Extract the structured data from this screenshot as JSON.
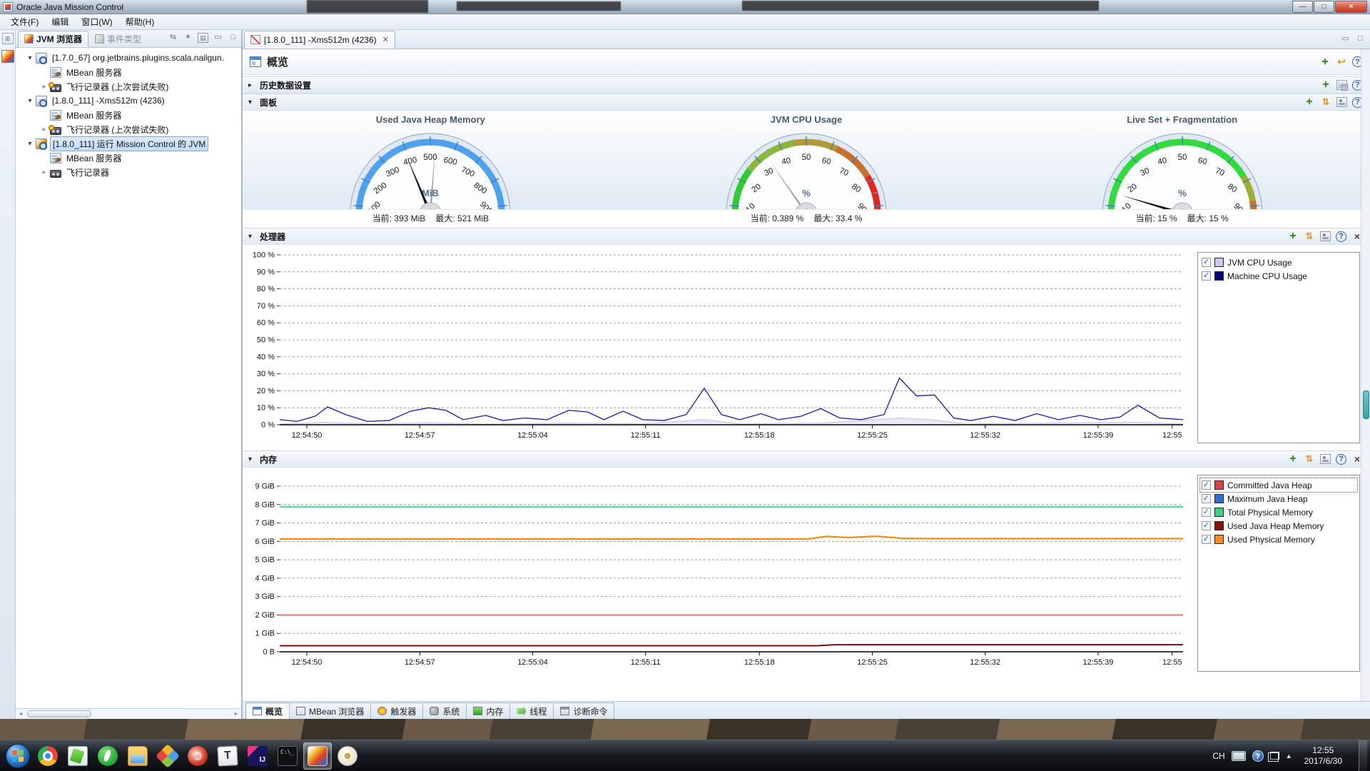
{
  "window": {
    "title": "Oracle Java Mission Control"
  },
  "menu": {
    "items": [
      "文件(F)",
      "编辑",
      "窗口(W)",
      "帮助(H)"
    ]
  },
  "sidebar": {
    "tabs": [
      {
        "label": "JVM 浏览器",
        "active": true
      },
      {
        "label": "事件类型",
        "active": false
      }
    ],
    "tree": [
      {
        "label": "[1.7.0_67] org.jetbrains.plugins.scala.nailgun.",
        "level": 0,
        "expander": "expanded",
        "icon": "jvm-connection-icon",
        "selected": false
      },
      {
        "label": "MBean 服务器",
        "level": 1,
        "expander": "none",
        "icon": "mbean-server-icon",
        "selected": false
      },
      {
        "label": "飞行记录器 (上次尝试失败)",
        "level": 1,
        "expander": "collapsed",
        "icon": "flight-recorder-warning-icon",
        "selected": false
      },
      {
        "label": "[1.8.0_111] -Xms512m (4236)",
        "level": 0,
        "expander": "expanded",
        "icon": "jvm-connection-icon",
        "selected": false
      },
      {
        "label": "MBean 服务器",
        "level": 1,
        "expander": "none",
        "icon": "mbean-server-icon",
        "selected": false
      },
      {
        "label": "飞行记录器 (上次尝试失败)",
        "level": 1,
        "expander": "collapsed",
        "icon": "flight-recorder-warning-icon",
        "selected": false
      },
      {
        "label": "[1.8.0_111] 运行 Mission Control 的 JVM",
        "level": 0,
        "expander": "expanded",
        "icon": "jvm-mc-icon",
        "selected": true
      },
      {
        "label": "MBean 服务器",
        "level": 1,
        "expander": "none",
        "icon": "mbean-server-icon",
        "selected": false
      },
      {
        "label": "飞行记录器",
        "level": 1,
        "expander": "collapsed",
        "icon": "flight-recorder-icon",
        "selected": false
      }
    ]
  },
  "editor": {
    "tab": {
      "label": "[1.8.0_111] -Xms512m (4236)"
    },
    "overview_title": "概览",
    "history_title": "历史数据设置",
    "dashboard_title": "面板",
    "processor_title": "处理器",
    "memory_title": "内存",
    "gauges": [
      {
        "title": "Used Java Heap Memory",
        "unit": "MiB",
        "min": 0,
        "max": 1000,
        "tick_step": 100,
        "ring": "blue",
        "current": 393,
        "peak": 521,
        "current_label": "当前: 393 MiB",
        "peak_label": "最大: 521 MiB"
      },
      {
        "title": "JVM CPU Usage",
        "unit": "%",
        "min": 0,
        "max": 100,
        "tick_step": 10,
        "ring": "cpu",
        "current": 0.389,
        "peak": 33.4,
        "current_label": "当前: 0.389 %",
        "peak_label": "最大: 33.4 %"
      },
      {
        "title": "Live Set + Fragmentation",
        "unit": "%",
        "min": 0,
        "max": 100,
        "tick_step": 10,
        "ring": "live",
        "current": 15,
        "peak": 15,
        "current_label": "当前: 15 %",
        "peak_label": "最大: 15 %"
      }
    ],
    "processor_legend": [
      {
        "label": "JVM CPU Usage",
        "color": "#c9c9f0",
        "checked": true,
        "focused": false
      },
      {
        "label": "Machine CPU Usage",
        "color": "#000080",
        "checked": true,
        "focused": false
      }
    ],
    "memory_legend": [
      {
        "label": "Committed Java Heap",
        "color": "#d94444",
        "checked": true,
        "focused": true
      },
      {
        "label": "Maximum Java Heap",
        "color": "#2f6fd0",
        "checked": true,
        "focused": false
      },
      {
        "label": "Total Physical Memory",
        "color": "#3ed080",
        "checked": true,
        "focused": false
      },
      {
        "label": "Used Java Heap Memory",
        "color": "#8a0f0f",
        "checked": true,
        "focused": false
      },
      {
        "label": "Used Physical Memory",
        "color": "#f78c1e",
        "checked": true,
        "focused": false
      }
    ],
    "bottom_tabs": [
      {
        "label": "概览",
        "icon": "overview-icon",
        "active": true
      },
      {
        "label": "MBean 浏览器",
        "icon": "mbean-icon",
        "active": false
      },
      {
        "label": "触发器",
        "icon": "trigger-icon",
        "active": false
      },
      {
        "label": "系统",
        "icon": "system-icon",
        "active": false
      },
      {
        "label": "内存",
        "icon": "memory-chip-icon",
        "active": false
      },
      {
        "label": "线程",
        "icon": "threads-icon",
        "active": false
      },
      {
        "label": "诊断命令",
        "icon": "diagnostic-icon",
        "active": false
      }
    ]
  },
  "chart_data": [
    {
      "type": "line",
      "title": "处理器",
      "ylim": [
        0,
        100
      ],
      "grid": true,
      "legend_position": "right",
      "yticks": [
        {
          "v": 100,
          "label": "100 %"
        },
        {
          "v": 90,
          "label": "90 %"
        },
        {
          "v": 80,
          "label": "80 %"
        },
        {
          "v": 70,
          "label": "70 %"
        },
        {
          "v": 60,
          "label": "60 %"
        },
        {
          "v": 50,
          "label": "50 %"
        },
        {
          "v": 40,
          "label": "40 %"
        },
        {
          "v": 30,
          "label": "30 %"
        },
        {
          "v": 20,
          "label": "20 %"
        },
        {
          "v": 10,
          "label": "10 %"
        },
        {
          "v": 0,
          "label": "0 %"
        }
      ],
      "xticks": [
        {
          "f": 0.03,
          "label": "12:54:50"
        },
        {
          "f": 0.155,
          "label": "12:54:57"
        },
        {
          "f": 0.28,
          "label": "12:55:04"
        },
        {
          "f": 0.405,
          "label": "12:55:11"
        },
        {
          "f": 0.531,
          "label": "12:55:18"
        },
        {
          "f": 0.656,
          "label": "12:55:25"
        },
        {
          "f": 0.781,
          "label": "12:55:32"
        },
        {
          "f": 0.906,
          "label": "12:55:39"
        },
        {
          "f": 0.988,
          "label": "12:55"
        }
      ],
      "series": [
        {
          "name": "JVM CPU Usage",
          "color": "#c9c9ee",
          "width": 1.2,
          "area": true,
          "points": [
            [
              0,
              0.5
            ],
            [
              0.05,
              1.5
            ],
            [
              0.1,
              0.4
            ],
            [
              0.165,
              1.2
            ],
            [
              0.22,
              0.4
            ],
            [
              0.32,
              1.0
            ],
            [
              0.4,
              0.5
            ],
            [
              0.47,
              3.0
            ],
            [
              0.51,
              0.5
            ],
            [
              0.6,
              1.0
            ],
            [
              0.686,
              4.0
            ],
            [
              0.72,
              3.0
            ],
            [
              0.76,
              0.5
            ],
            [
              0.85,
              1.0
            ],
            [
              0.95,
              1.5
            ],
            [
              1,
              0.5
            ]
          ]
        },
        {
          "name": "Machine CPU Usage",
          "color": "#1a1aa0",
          "width": 1.3,
          "area": false,
          "points": [
            [
              0,
              3
            ],
            [
              0.019,
              2
            ],
            [
              0.039,
              5
            ],
            [
              0.053,
              10.5
            ],
            [
              0.073,
              6
            ],
            [
              0.097,
              2
            ],
            [
              0.121,
              2.5
            ],
            [
              0.145,
              8
            ],
            [
              0.165,
              10
            ],
            [
              0.184,
              8.5
            ],
            [
              0.203,
              3
            ],
            [
              0.228,
              5.5
            ],
            [
              0.247,
              2.5
            ],
            [
              0.271,
              4
            ],
            [
              0.296,
              3
            ],
            [
              0.32,
              8.5
            ],
            [
              0.341,
              7.5
            ],
            [
              0.359,
              3
            ],
            [
              0.38,
              8
            ],
            [
              0.402,
              3
            ],
            [
              0.426,
              2.5
            ],
            [
              0.45,
              6
            ],
            [
              0.47,
              21.5
            ],
            [
              0.489,
              6
            ],
            [
              0.509,
              3
            ],
            [
              0.533,
              6.5
            ],
            [
              0.552,
              3
            ],
            [
              0.577,
              5
            ],
            [
              0.599,
              9.5
            ],
            [
              0.62,
              4
            ],
            [
              0.644,
              3
            ],
            [
              0.669,
              6
            ],
            [
              0.686,
              27.5
            ],
            [
              0.705,
              17
            ],
            [
              0.725,
              17.5
            ],
            [
              0.746,
              4
            ],
            [
              0.765,
              2.5
            ],
            [
              0.79,
              5
            ],
            [
              0.814,
              2.5
            ],
            [
              0.838,
              6.5
            ],
            [
              0.862,
              3
            ],
            [
              0.886,
              5.5
            ],
            [
              0.909,
              3
            ],
            [
              0.93,
              4.5
            ],
            [
              0.95,
              11.5
            ],
            [
              0.974,
              4
            ],
            [
              1,
              3
            ]
          ]
        }
      ]
    },
    {
      "type": "line",
      "title": "内存",
      "ylim": [
        0,
        9
      ],
      "grid": true,
      "legend_position": "right",
      "yticks": [
        {
          "v": 9,
          "label": "9 GiB"
        },
        {
          "v": 8,
          "label": "8 GiB"
        },
        {
          "v": 7,
          "label": "7 GiB"
        },
        {
          "v": 6,
          "label": "6 GiB"
        },
        {
          "v": 5,
          "label": "5 GiB"
        },
        {
          "v": 4,
          "label": "4 GiB"
        },
        {
          "v": 3,
          "label": "3 GiB"
        },
        {
          "v": 2,
          "label": "2 GiB"
        },
        {
          "v": 1,
          "label": "1 GiB"
        },
        {
          "v": 0,
          "label": "0 B"
        }
      ],
      "xticks": [
        {
          "f": 0.03,
          "label": "12:54:50"
        },
        {
          "f": 0.155,
          "label": "12:54:57"
        },
        {
          "f": 0.28,
          "label": "12:55:04"
        },
        {
          "f": 0.405,
          "label": "12:55:11"
        },
        {
          "f": 0.531,
          "label": "12:55:18"
        },
        {
          "f": 0.656,
          "label": "12:55:25"
        },
        {
          "f": 0.781,
          "label": "12:55:32"
        },
        {
          "f": 0.906,
          "label": "12:55:39"
        },
        {
          "f": 0.988,
          "label": "12:55"
        }
      ],
      "series": [
        {
          "name": "Total Physical Memory",
          "color": "#5adf9b",
          "width": 2.2,
          "area": false,
          "points": [
            [
              0,
              7.88
            ],
            [
              1,
              7.88
            ]
          ]
        },
        {
          "name": "Used Physical Memory",
          "color": "#f08a18",
          "width": 2.2,
          "area": false,
          "points": [
            [
              0,
              6.13
            ],
            [
              0.55,
              6.13
            ],
            [
              0.585,
              6.13
            ],
            [
              0.605,
              6.27
            ],
            [
              0.63,
              6.21
            ],
            [
              0.66,
              6.28
            ],
            [
              0.69,
              6.16
            ],
            [
              0.72,
              6.15
            ],
            [
              1,
              6.15
            ]
          ]
        },
        {
          "name": "Maximum Java Heap",
          "color": "#2f6fd0",
          "width": 2,
          "area": false,
          "points": [
            [
              0,
              2.0
            ],
            [
              1,
              2.0
            ]
          ]
        },
        {
          "name": "Committed Java Heap",
          "color": "#e07878",
          "width": 2,
          "area": false,
          "points": [
            [
              0,
              2.0
            ],
            [
              1,
              2.0
            ]
          ]
        },
        {
          "name": "Used Java Heap Memory",
          "color": "#7a0c0c",
          "width": 2,
          "area": false,
          "points": [
            [
              0,
              0.33
            ],
            [
              0.595,
              0.33
            ],
            [
              0.615,
              0.385
            ],
            [
              1,
              0.385
            ]
          ]
        }
      ]
    }
  ],
  "taskbar": {
    "icons": [
      {
        "name": "start-button",
        "active": false
      },
      {
        "name": "chrome-icon",
        "active": false
      },
      {
        "name": "notepad-icon",
        "active": false
      },
      {
        "name": "green-app-icon",
        "active": false
      },
      {
        "name": "explorer-icon",
        "active": false
      },
      {
        "name": "version-control-icon",
        "active": false
      },
      {
        "name": "snail-app-icon",
        "active": false
      },
      {
        "name": "typora-icon",
        "active": false
      },
      {
        "name": "intellij-icon",
        "active": false
      },
      {
        "name": "terminal-icon",
        "active": false
      },
      {
        "name": "mission-control-icon",
        "active": true
      },
      {
        "name": "jar-app-icon",
        "active": false
      }
    ],
    "tray": {
      "lang": "CH",
      "time": "12:55",
      "date": "2017/6/30"
    }
  }
}
